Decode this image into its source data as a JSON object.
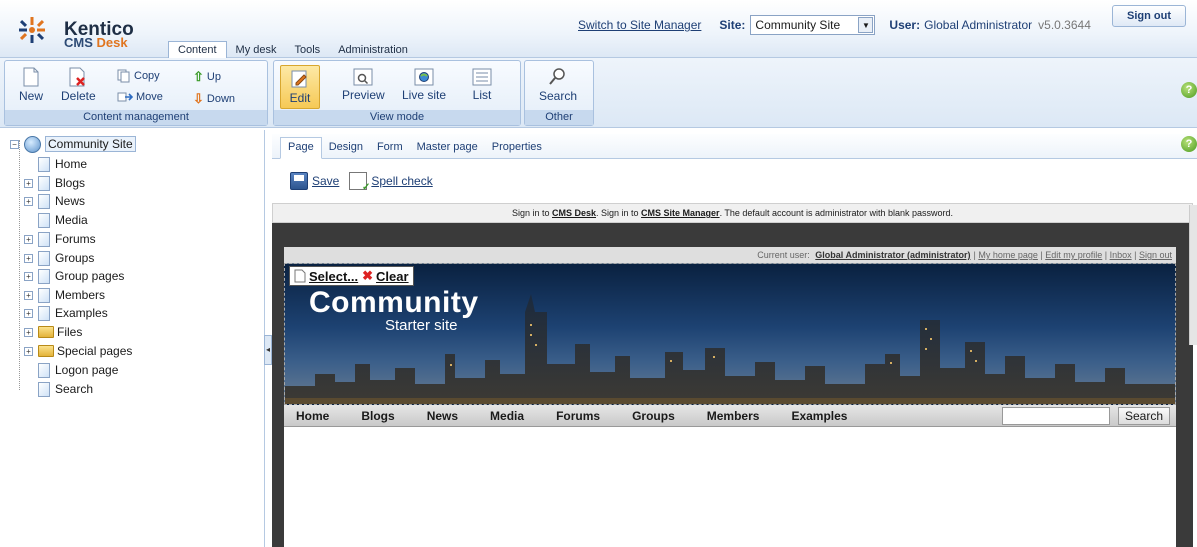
{
  "app": {
    "brand_name": "Kentico",
    "brand_sub_prefix": "CMS ",
    "brand_sub_accent": "Desk",
    "accent_color": "#e07520"
  },
  "main_tabs": [
    "Content",
    "My desk",
    "Tools",
    "Administration"
  ],
  "topbar": {
    "switch_link": "Switch to Site Manager",
    "site_label": "Site:",
    "site_value": "Community Site",
    "user_label": "User:",
    "user_name": "Global Administrator",
    "version": "v5.0.3644",
    "signout": "Sign out"
  },
  "ribbon": {
    "content_management": {
      "title": "Content management",
      "new": "New",
      "delete": "Delete",
      "copy": "Copy",
      "move": "Move",
      "up": "Up",
      "down": "Down"
    },
    "view_mode": {
      "title": "View mode",
      "edit": "Edit",
      "preview": "Preview",
      "live_site": "Live site",
      "list": "List"
    },
    "other": {
      "title": "Other",
      "search": "Search"
    }
  },
  "tree": {
    "root": "Community Site",
    "items": [
      {
        "label": "Home",
        "type": "page",
        "expandable": false
      },
      {
        "label": "Blogs",
        "type": "page",
        "expandable": true
      },
      {
        "label": "News",
        "type": "page",
        "expandable": true
      },
      {
        "label": "Media",
        "type": "page",
        "expandable": false
      },
      {
        "label": "Forums",
        "type": "page",
        "expandable": true
      },
      {
        "label": "Groups",
        "type": "page",
        "expandable": true
      },
      {
        "label": "Group pages",
        "type": "page",
        "expandable": true
      },
      {
        "label": "Members",
        "type": "page",
        "expandable": true
      },
      {
        "label": "Examples",
        "type": "page",
        "expandable": true
      },
      {
        "label": "Files",
        "type": "folder",
        "expandable": true
      },
      {
        "label": "Special pages",
        "type": "folder",
        "expandable": true
      },
      {
        "label": "Logon page",
        "type": "page",
        "expandable": false
      },
      {
        "label": "Search",
        "type": "page",
        "expandable": false
      }
    ]
  },
  "sub_tabs": [
    "Page",
    "Design",
    "Form",
    "Master page",
    "Properties"
  ],
  "toolbar": {
    "save": "Save",
    "spell_check": "Spell check"
  },
  "signin_bar": {
    "part1": "Sign in to ",
    "link1": "CMS Desk",
    "part2": ". Sign in to ",
    "link2": "CMS Site Manager",
    "part3": ". The default account is administrator with blank password."
  },
  "preview": {
    "userbar_label": "Current user:",
    "userbar_name": "Global Administrator (administrator)",
    "links": [
      "My home page",
      "Edit my profile",
      "Inbox",
      "Sign out"
    ],
    "select_link": "Select...",
    "clear_link": "Clear",
    "banner_title": "Community",
    "banner_subtitle": "Starter site",
    "nav": [
      "Home",
      "Blogs",
      "News",
      "Media",
      "Forums",
      "Groups",
      "Members",
      "Examples"
    ],
    "search_button": "Search"
  }
}
